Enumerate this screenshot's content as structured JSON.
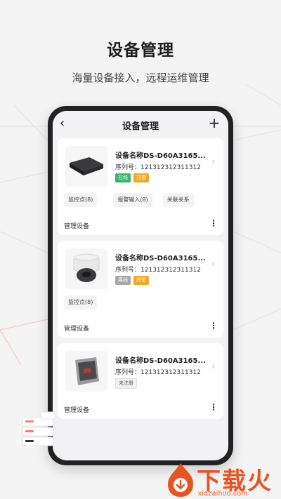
{
  "promo": {
    "title": "设备管理",
    "subtitle": "海量设备接入，远程运维管理"
  },
  "navbar": {
    "title": "设备管理",
    "back_icon": "chevron-left-icon",
    "add_icon": "plus-icon",
    "back_glyph": "‹",
    "add_glyph": "+"
  },
  "devices": [
    {
      "name": "设备名称DS-D60A3165...",
      "serial": "序列号：121312312311312",
      "tags": [
        "在线",
        "托管"
      ],
      "tag_colors": [
        "#3cb371",
        "#f5a623"
      ],
      "actions": [
        "监控点(8)",
        "报警输入(8)",
        "关联关系"
      ],
      "manage_label": "管理设备"
    },
    {
      "name": "设备名称DS-D60A3165...",
      "serial": "序列号：121312312311312",
      "tags": [
        "离线",
        "托管"
      ],
      "tag_colors": [
        "#a6a6a6",
        "#f5a623"
      ],
      "actions": [
        "监控点(8)"
      ],
      "manage_label": "管理设备"
    },
    {
      "name": "设备名称DS-D60A3165...",
      "serial": "序列号：121312312311312",
      "tags": [
        "未注册"
      ],
      "tag_colors": [
        "#f1f1f1"
      ],
      "actions": [],
      "manage_label": "管理设备"
    }
  ],
  "glyphs": {
    "chevron_right": "›",
    "more": "⋮"
  },
  "watermark": {
    "text": "下载火",
    "url": "xiazaihuo.com"
  },
  "colors": {
    "accent_green": "#3cb371",
    "accent_orange": "#f5a623",
    "offline_gray": "#a6a6a6",
    "watermark_orange": "#e95320"
  }
}
